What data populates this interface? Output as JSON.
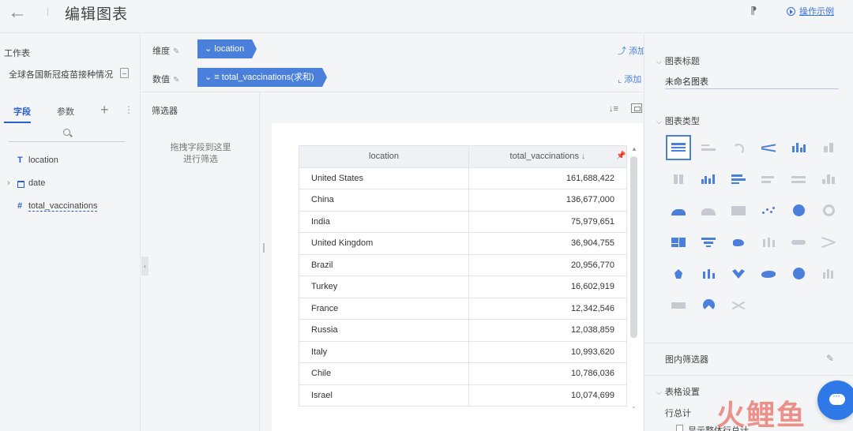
{
  "header": {
    "title": "编辑图表",
    "help_link": "操作示例"
  },
  "left": {
    "section_title": "工作表",
    "dataset_name": "全球各国新冠疫苗接种情况",
    "tabs": [
      "字段",
      "参数"
    ],
    "fields": [
      {
        "type": "T",
        "name": "location"
      },
      {
        "type": "calendar",
        "name": "date"
      },
      {
        "type": "#",
        "name": "total_vaccinations"
      }
    ]
  },
  "middle": {
    "dimension_label": "维度",
    "dimension_pill": "location",
    "measure_label": "数值",
    "measure_pill": "total_vaccinations(求和)",
    "add_label": "添加",
    "filter_title": "筛选器",
    "filter_hint_1": "拖拽字段到这里",
    "filter_hint_2": "进行筛选"
  },
  "table": {
    "columns": [
      "location",
      "total_vaccinations"
    ],
    "rows": [
      [
        "United States",
        "161,688,422"
      ],
      [
        "China",
        "136,677,000"
      ],
      [
        "India",
        "75,979,651"
      ],
      [
        "United Kingdom",
        "36,904,755"
      ],
      [
        "Brazil",
        "20,956,770"
      ],
      [
        "Turkey",
        "16,602,919"
      ],
      [
        "France",
        "12,342,546"
      ],
      [
        "Russia",
        "12,038,859"
      ],
      [
        "Italy",
        "10,993,620"
      ],
      [
        "Chile",
        "10,786,036"
      ],
      [
        "Israel",
        "10,074,699"
      ]
    ]
  },
  "right": {
    "chart_title_section": "图表标题",
    "chart_title_value": "未命名图表",
    "chart_type_section": "图表类型",
    "inner_filter": "图内筛选器",
    "table_settings": "表格设置",
    "row_total": "行总计",
    "show_row_total": "显示整体行总计"
  },
  "colors": {
    "accent": "#4a7fdb",
    "link": "#3a6fd8",
    "panel_bg": "#f4f5f7"
  },
  "watermark": "火鲤鱼"
}
